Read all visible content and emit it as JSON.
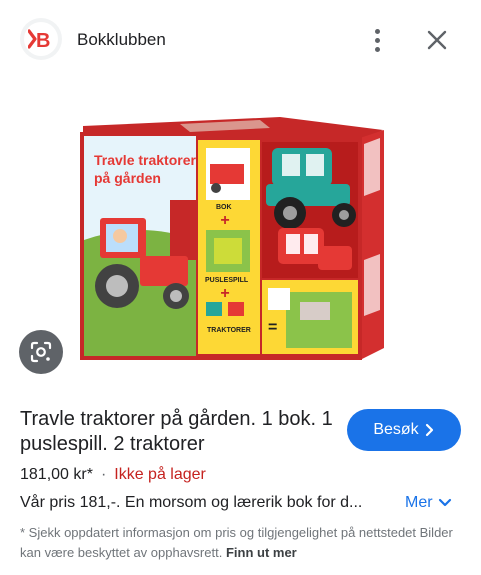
{
  "header": {
    "logo_letter": "B",
    "site_name": "Bokklubben",
    "more_icon": "more-vert-icon",
    "close_icon": "close-icon"
  },
  "image": {
    "box_title_line1": "Travle traktorer",
    "box_title_line2": "på gården",
    "label_bok": "BOK",
    "label_puslespill": "PUSLESPILL",
    "label_traktorer": "TRAKTORER",
    "plus": "+",
    "equals": "="
  },
  "lens_icon": "lens-icon",
  "product": {
    "title": "Travle traktorer på gården. 1 bok. 1 puslespill. 2 traktorer",
    "visit_label": "Besøk",
    "price": "181,00 kr*",
    "separator": "·",
    "stock_status": "Ikke på lager",
    "description": "Vår pris 181,-. En morsom og lærerik bok for d...",
    "more_label": "Mer"
  },
  "disclaimer": {
    "text": "* Sjekk oppdatert informasjon om pris og tilgjengelighet på nettstedet Bilder kan være beskyttet av opphavsrett.",
    "link": "Finn ut mer"
  },
  "colors": {
    "accent": "#1a73e8",
    "out_of_stock": "#c5221f",
    "logo_red": "#e53935"
  }
}
